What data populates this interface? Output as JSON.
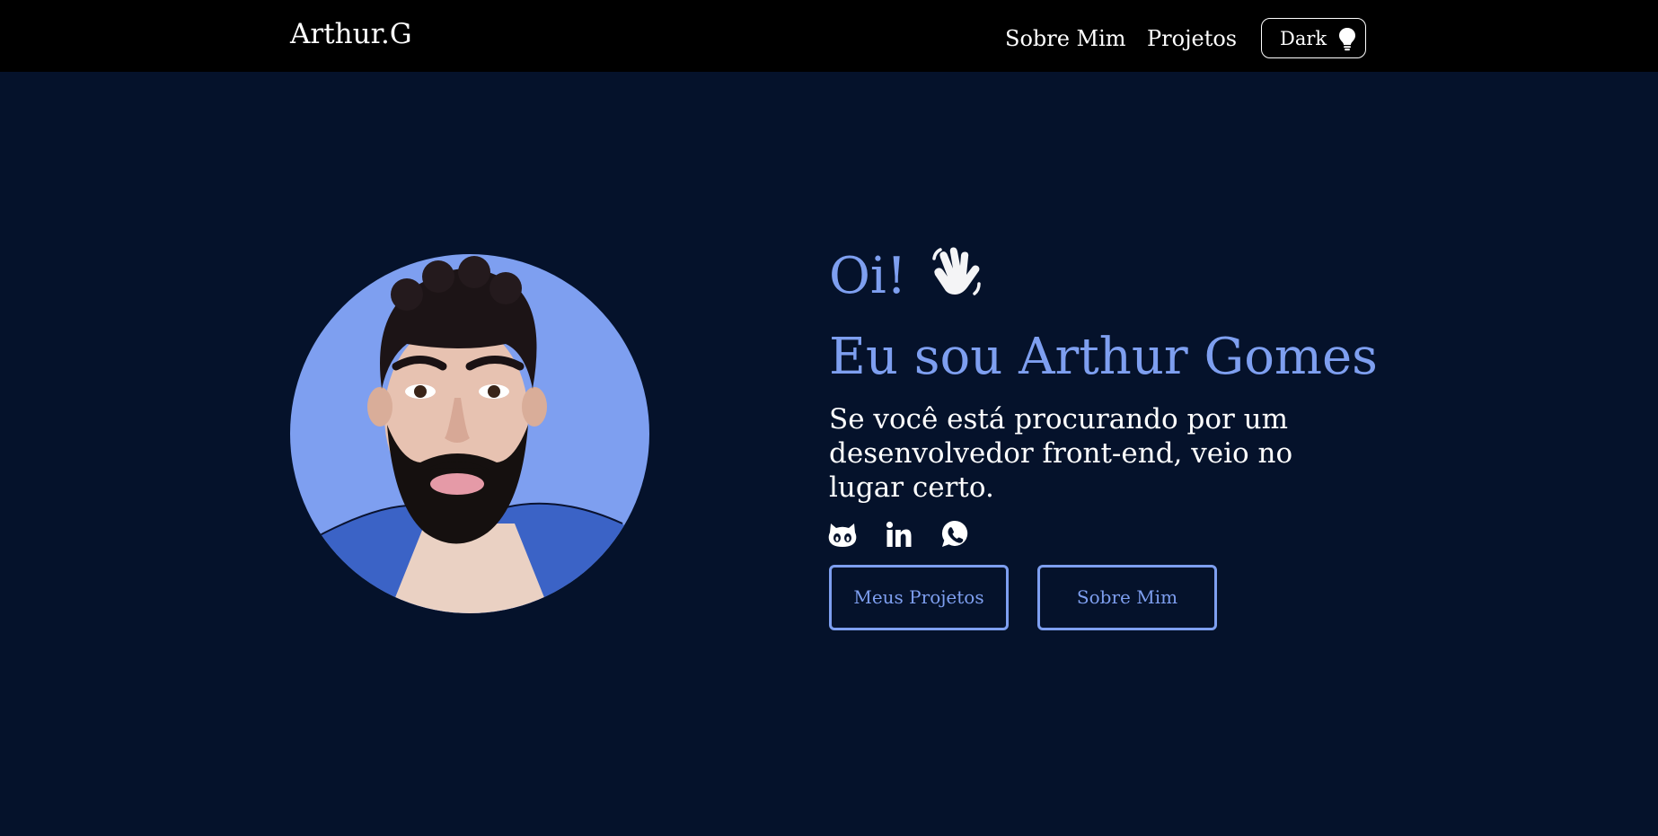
{
  "header": {
    "logo": "Arthur.G",
    "nav": [
      {
        "label": "Sobre Mim"
      },
      {
        "label": "Projetos"
      }
    ],
    "theme_toggle": {
      "label": "Dark",
      "icon": "lightbulb-icon"
    }
  },
  "hero": {
    "greeting": "Oi!",
    "greeting_icon": "waving-hand-icon",
    "heading": "Eu sou Arthur Gomes",
    "tagline": "Se você está procurando por um desenvolvedor front-end, veio no lugar certo.",
    "social": [
      {
        "icon": "github-icon"
      },
      {
        "icon": "linkedin-icon"
      },
      {
        "icon": "whatsapp-icon"
      }
    ],
    "buttons": {
      "projects": "Meus Projetos",
      "about": "Sobre Mim"
    }
  },
  "colors": {
    "background": "#05122b",
    "navbar": "#000000",
    "accent": "#7e9ff0",
    "text": "#ffffff"
  }
}
